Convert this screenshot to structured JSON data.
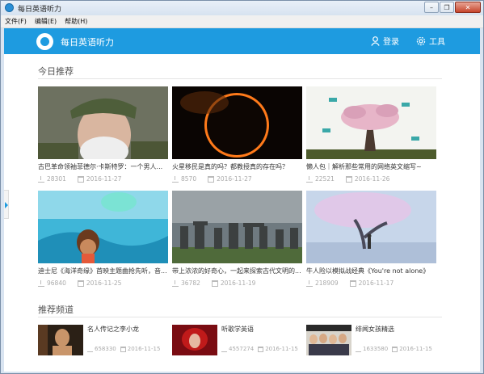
{
  "window": {
    "title": "每日英语听力",
    "min_icon": "minimize-icon",
    "max_icon": "restore-icon",
    "close_icon": "close-icon"
  },
  "menu": [
    {
      "label": "文件(F)"
    },
    {
      "label": "编辑(E)"
    },
    {
      "label": "帮助(H)"
    }
  ],
  "header": {
    "title": "每日英语听力",
    "login_label": "登录",
    "tools_label": "工具",
    "brand_color": "#1e9be0"
  },
  "today": {
    "title": "今日推荐",
    "cards": [
      {
        "title": "古巴革命领袖菲德尔·卡斯特罗：一个男人...",
        "downloads": "28301",
        "date": "2016-11-27"
      },
      {
        "title": "火星移民是真的吗？都教授真的存在吗？",
        "downloads": "8570",
        "date": "2016-11-27"
      },
      {
        "title": "懒人包｜解析那些常用的网络英文缩写~",
        "downloads": "22521",
        "date": "2016-11-26"
      },
      {
        "title": "迪士尼《海洋奇缘》首映主题曲抢先听，音...",
        "downloads": "96840",
        "date": "2016-11-25"
      },
      {
        "title": "带上浓浓的好奇心，一起来探索古代文明的...",
        "downloads": "36782",
        "date": "2016-11-19"
      },
      {
        "title": "牛人险以模拟战经典《You're not alone》",
        "downloads": "218909",
        "date": "2016-11-17"
      }
    ]
  },
  "channels": {
    "title": "推荐频道",
    "items": [
      {
        "name": "名人传记之李小龙",
        "count": "658330",
        "date": "2016-11-15"
      },
      {
        "name": "听歌学英语",
        "count": "4557274",
        "date": "2016-11-15"
      },
      {
        "name": "绯闻女孩精选",
        "count": "1633580",
        "date": "2016-11-15"
      }
    ]
  }
}
